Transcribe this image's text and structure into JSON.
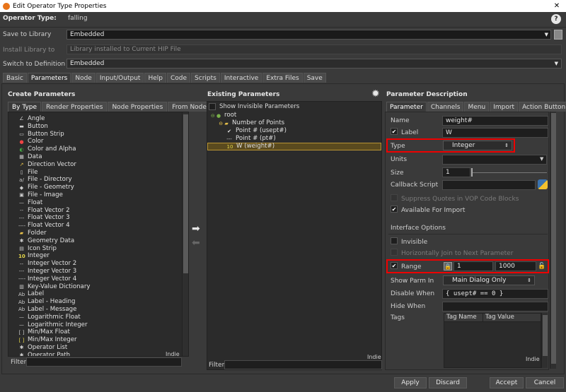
{
  "window": {
    "title": "Edit Operator Type Properties",
    "close": "✕"
  },
  "top": {
    "operator_type_label": "Operator Type:",
    "operator_type_value": "falling",
    "help": "?",
    "save_to_library_label": "Save to Library",
    "save_to_library_value": "Embedded",
    "install_library_label": "Install Library to",
    "install_library_value": "Library installed to Current HIP File",
    "switch_def_label": "Switch to Definition",
    "switch_def_value": "Embedded"
  },
  "main_tabs": [
    "Basic",
    "Parameters",
    "Node",
    "Input/Output",
    "Help",
    "Code",
    "Scripts",
    "Interactive",
    "Extra Files",
    "Save"
  ],
  "create": {
    "title": "Create Parameters",
    "tabs": [
      "By Type",
      "Render Properties",
      "Node Properties",
      "From Nodes"
    ],
    "items": [
      {
        "icon": "angle-icon",
        "glyph": "∠",
        "label": "Angle"
      },
      {
        "icon": "button-icon",
        "glyph": "▬",
        "label": "Button"
      },
      {
        "icon": "button-strip-icon",
        "glyph": "▭",
        "label": "Button Strip"
      },
      {
        "icon": "color-icon",
        "glyph": "●",
        "label": "Color"
      },
      {
        "icon": "color-alpha-icon",
        "glyph": "◐",
        "label": "Color and Alpha"
      },
      {
        "icon": "data-icon",
        "glyph": "▦",
        "label": "Data"
      },
      {
        "icon": "direction-vector-icon",
        "glyph": "↗",
        "label": "Direction Vector"
      },
      {
        "icon": "file-icon",
        "glyph": "▯",
        "label": "File"
      },
      {
        "icon": "file-directory-icon",
        "glyph": "a/",
        "label": "File - Directory"
      },
      {
        "icon": "file-geometry-icon",
        "glyph": "◆",
        "label": "File - Geometry"
      },
      {
        "icon": "file-image-icon",
        "glyph": "▣",
        "label": "File - Image"
      },
      {
        "icon": "float-icon",
        "glyph": "—",
        "label": "Float"
      },
      {
        "icon": "float-vector2-icon",
        "glyph": "--",
        "label": "Float Vector 2"
      },
      {
        "icon": "float-vector3-icon",
        "glyph": "---",
        "label": "Float Vector 3"
      },
      {
        "icon": "float-vector4-icon",
        "glyph": "----",
        "label": "Float Vector 4"
      },
      {
        "icon": "folder-icon",
        "glyph": "▰",
        "label": "Folder"
      },
      {
        "icon": "geometry-data-icon",
        "glyph": "✱",
        "label": "Geometry Data"
      },
      {
        "icon": "icon-strip-icon",
        "glyph": "▤",
        "label": "Icon Strip"
      },
      {
        "icon": "integer-icon",
        "glyph": "10",
        "label": "Integer"
      },
      {
        "icon": "integer-vector2-icon",
        "glyph": "--",
        "label": "Integer Vector 2"
      },
      {
        "icon": "integer-vector3-icon",
        "glyph": "---",
        "label": "Integer Vector 3"
      },
      {
        "icon": "integer-vector4-icon",
        "glyph": "----",
        "label": "Integer Vector 4"
      },
      {
        "icon": "key-value-icon",
        "glyph": "▥",
        "label": "Key-Value Dictionary"
      },
      {
        "icon": "label-icon",
        "glyph": "Ab",
        "label": "Label"
      },
      {
        "icon": "label-heading-icon",
        "glyph": "Ab",
        "label": "Label - Heading"
      },
      {
        "icon": "label-message-icon",
        "glyph": "Ab",
        "label": "Label - Message"
      },
      {
        "icon": "log-float-icon",
        "glyph": "—",
        "label": "Logarithmic Float"
      },
      {
        "icon": "log-integer-icon",
        "glyph": "—",
        "label": "Logarithmic Integer"
      },
      {
        "icon": "minmax-float-icon",
        "glyph": "[ ]",
        "label": "Min/Max Float"
      },
      {
        "icon": "minmax-integer-icon",
        "glyph": "[ ]",
        "label": "Min/Max Integer"
      },
      {
        "icon": "operator-list-icon",
        "glyph": "✱",
        "label": "Operator List"
      },
      {
        "icon": "operator-path-icon",
        "glyph": "✱",
        "label": "Operator Path"
      }
    ],
    "filter_label": "Filter",
    "indie": "Indie"
  },
  "existing": {
    "title": "Existing Parameters",
    "show_invisible": "Show Invisible Parameters",
    "tree": [
      {
        "label": "root",
        "level": 0
      },
      {
        "label": "Number of Points",
        "level": 1
      },
      {
        "label": "Point # (usept#)",
        "level": 2
      },
      {
        "label": "Point # (pt#)",
        "level": 2
      },
      {
        "label": "W (weight#)",
        "level": 2
      }
    ],
    "filter_label": "Filter",
    "indie": "Indie"
  },
  "desc": {
    "title": "Parameter Description",
    "tabs": [
      "Parameter",
      "Channels",
      "Menu",
      "Import",
      "Action Button"
    ],
    "name_label": "Name",
    "name_value": "weight#",
    "label_label": "Label",
    "label_value": "W",
    "type_label": "Type",
    "type_value": "Integer",
    "units_label": "Units",
    "size_label": "Size",
    "size_value": "1",
    "callback_label": "Callback Script",
    "suppress_label": "Suppress Quotes in VOP Code Blocks",
    "available_label": "Available For Import",
    "interface_label": "Interface Options",
    "invisible_label": "Invisible",
    "hjoin_label": "Horizontally Join to Next Parameter",
    "range_label": "Range",
    "range_min": "1",
    "range_max": "1000",
    "showparm_label": "Show Parm In",
    "showparm_value": "Main Dialog Only",
    "disable_label": "Disable When",
    "disable_value": "{ usept# == 0 }",
    "hide_label": "Hide When",
    "tags_label": "Tags",
    "tag_name": "Tag Name",
    "tag_value": "Tag Value",
    "indie": "Indie"
  },
  "buttons": {
    "apply": "Apply",
    "discard": "Discard",
    "accept": "Accept",
    "cancel": "Cancel"
  }
}
